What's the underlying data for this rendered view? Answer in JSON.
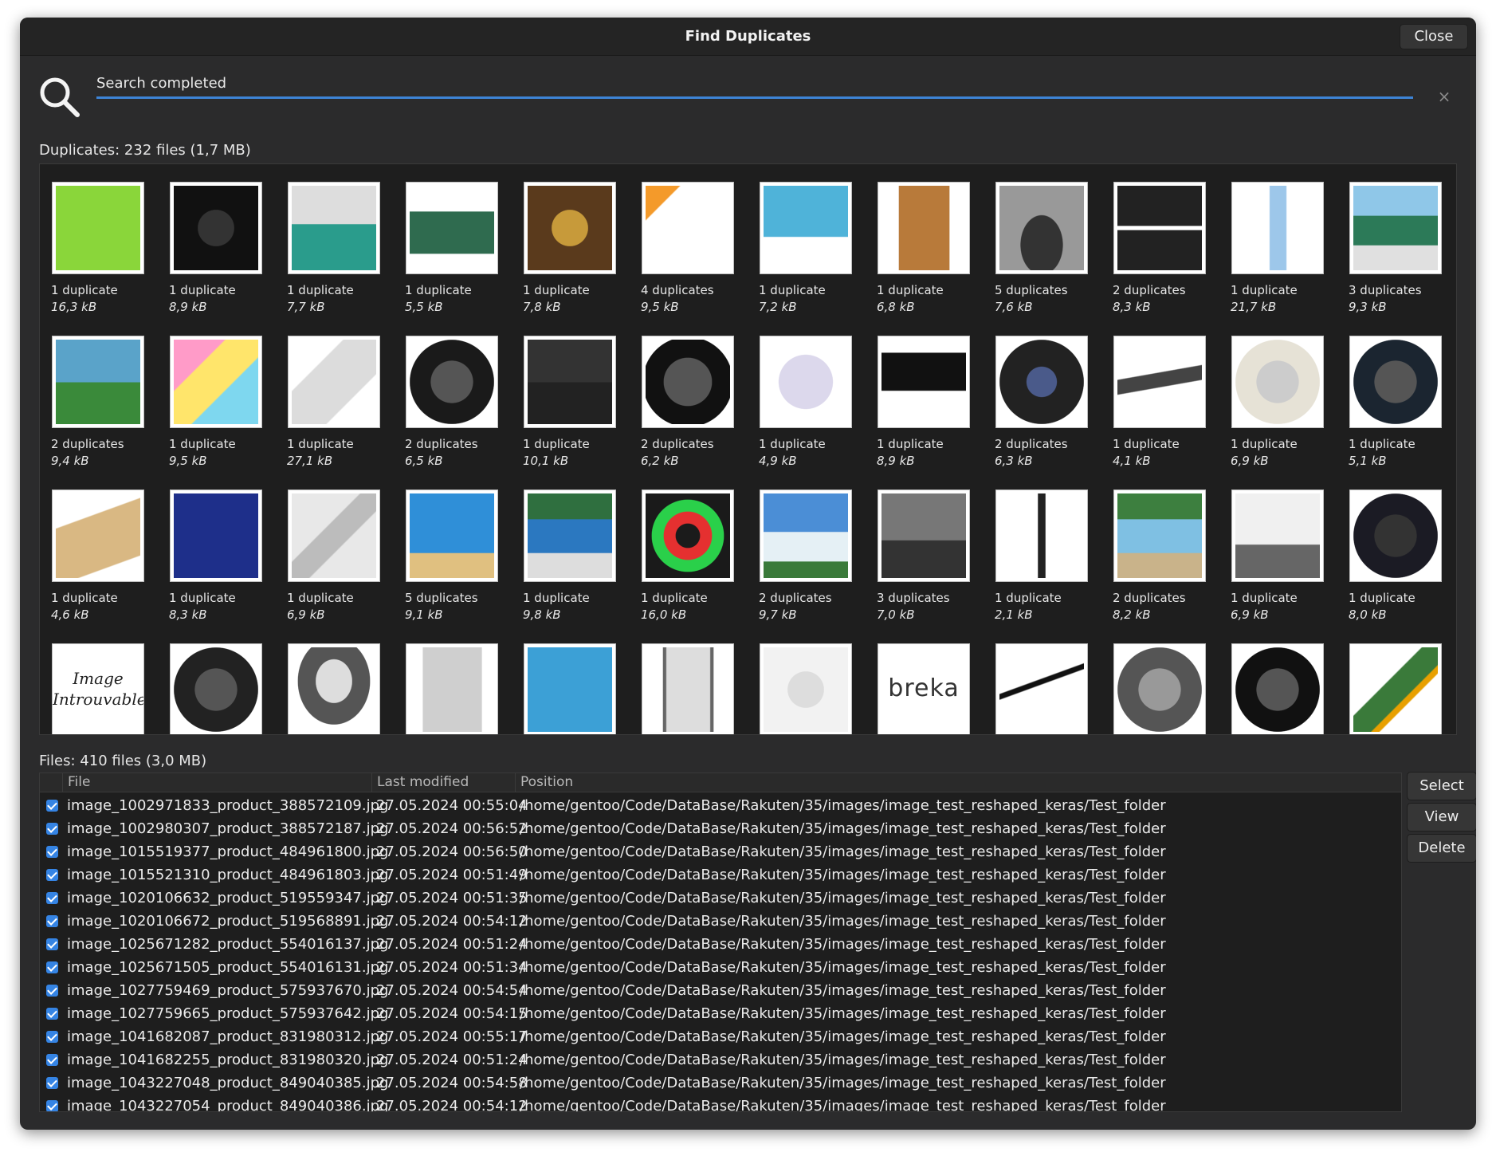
{
  "window": {
    "title": "Find Duplicates",
    "close_label": "Close"
  },
  "search": {
    "status": "Search completed",
    "progress": 1.0,
    "cancel_label": "×"
  },
  "duplicates": {
    "summary": "Duplicates: 232 files (1,7 MB)",
    "items": [
      {
        "count": "1 duplicate",
        "size": "16,3 kB"
      },
      {
        "count": "1 duplicate",
        "size": "8,9 kB"
      },
      {
        "count": "1 duplicate",
        "size": "7,7 kB"
      },
      {
        "count": "1 duplicate",
        "size": "5,5 kB"
      },
      {
        "count": "1 duplicate",
        "size": "7,8 kB"
      },
      {
        "count": "4 duplicates",
        "size": "9,5 kB"
      },
      {
        "count": "1 duplicate",
        "size": "7,2 kB"
      },
      {
        "count": "1 duplicate",
        "size": "6,8 kB"
      },
      {
        "count": "5 duplicates",
        "size": "7,6 kB"
      },
      {
        "count": "2 duplicates",
        "size": "8,3 kB"
      },
      {
        "count": "1 duplicate",
        "size": "21,7 kB"
      },
      {
        "count": "3 duplicates",
        "size": "9,3 kB"
      },
      {
        "count": "2 duplicates",
        "size": "9,4 kB"
      },
      {
        "count": "1 duplicate",
        "size": "9,5 kB"
      },
      {
        "count": "1 duplicate",
        "size": "27,1 kB"
      },
      {
        "count": "2 duplicates",
        "size": "6,5 kB"
      },
      {
        "count": "1 duplicate",
        "size": "10,1 kB"
      },
      {
        "count": "2 duplicates",
        "size": "6,2 kB"
      },
      {
        "count": "1 duplicate",
        "size": "4,9 kB"
      },
      {
        "count": "1 duplicate",
        "size": "8,9 kB"
      },
      {
        "count": "2 duplicates",
        "size": "6,3 kB"
      },
      {
        "count": "1 duplicate",
        "size": "4,1 kB"
      },
      {
        "count": "1 duplicate",
        "size": "6,9 kB"
      },
      {
        "count": "1 duplicate",
        "size": "5,1 kB"
      },
      {
        "count": "1 duplicate",
        "size": "4,6 kB"
      },
      {
        "count": "1 duplicate",
        "size": "8,3 kB"
      },
      {
        "count": "1 duplicate",
        "size": "6,9 kB"
      },
      {
        "count": "5 duplicates",
        "size": "9,1 kB"
      },
      {
        "count": "1 duplicate",
        "size": "9,8 kB"
      },
      {
        "count": "1 duplicate",
        "size": "16,0 kB"
      },
      {
        "count": "2 duplicates",
        "size": "9,7 kB"
      },
      {
        "count": "3 duplicates",
        "size": "7,0 kB"
      },
      {
        "count": "1 duplicate",
        "size": "2,1 kB"
      },
      {
        "count": "2 duplicates",
        "size": "8,2 kB"
      },
      {
        "count": "1 duplicate",
        "size": "6,9 kB"
      },
      {
        "count": "1 duplicate",
        "size": "8,0 kB"
      },
      {
        "count": "",
        "size": ""
      },
      {
        "count": "",
        "size": ""
      },
      {
        "count": "",
        "size": ""
      },
      {
        "count": "",
        "size": ""
      },
      {
        "count": "",
        "size": ""
      },
      {
        "count": "",
        "size": ""
      },
      {
        "count": "",
        "size": ""
      },
      {
        "count": "",
        "size": ""
      },
      {
        "count": "",
        "size": ""
      },
      {
        "count": "",
        "size": ""
      },
      {
        "count": "",
        "size": ""
      },
      {
        "count": "",
        "size": ""
      }
    ],
    "missing_image_text": "Image Introuvable",
    "brand_text": "breka"
  },
  "files": {
    "summary": "Files: 410 files (3,0 MB)",
    "columns": [
      "File",
      "Last modified",
      "Position"
    ],
    "rows": [
      {
        "checked": true,
        "file": "image_1002971833_product_388572109.jpg",
        "modified": "27.05.2024 00:55:04",
        "position": "/home/gentoo/Code/DataBase/Rakuten/35/images/image_test_reshaped_keras/Test_folder"
      },
      {
        "checked": true,
        "file": "image_1002980307_product_388572187.jpg",
        "modified": "27.05.2024 00:56:52",
        "position": "/home/gentoo/Code/DataBase/Rakuten/35/images/image_test_reshaped_keras/Test_folder"
      },
      {
        "checked": true,
        "file": "image_1015519377_product_484961800.jpg",
        "modified": "27.05.2024 00:56:50",
        "position": "/home/gentoo/Code/DataBase/Rakuten/35/images/image_test_reshaped_keras/Test_folder"
      },
      {
        "checked": true,
        "file": "image_1015521310_product_484961803.jpg",
        "modified": "27.05.2024 00:51:49",
        "position": "/home/gentoo/Code/DataBase/Rakuten/35/images/image_test_reshaped_keras/Test_folder"
      },
      {
        "checked": true,
        "file": "image_1020106632_product_519559347.jpg",
        "modified": "27.05.2024 00:51:35",
        "position": "/home/gentoo/Code/DataBase/Rakuten/35/images/image_test_reshaped_keras/Test_folder"
      },
      {
        "checked": true,
        "file": "image_1020106672_product_519568891.jpg",
        "modified": "27.05.2024 00:54:12",
        "position": "/home/gentoo/Code/DataBase/Rakuten/35/images/image_test_reshaped_keras/Test_folder"
      },
      {
        "checked": true,
        "file": "image_1025671282_product_554016137.jpg",
        "modified": "27.05.2024 00:51:24",
        "position": "/home/gentoo/Code/DataBase/Rakuten/35/images/image_test_reshaped_keras/Test_folder"
      },
      {
        "checked": true,
        "file": "image_1025671505_product_554016131.jpg",
        "modified": "27.05.2024 00:51:34",
        "position": "/home/gentoo/Code/DataBase/Rakuten/35/images/image_test_reshaped_keras/Test_folder"
      },
      {
        "checked": true,
        "file": "image_1027759469_product_575937670.jpg",
        "modified": "27.05.2024 00:54:54",
        "position": "/home/gentoo/Code/DataBase/Rakuten/35/images/image_test_reshaped_keras/Test_folder"
      },
      {
        "checked": true,
        "file": "image_1027759665_product_575937642.jpg",
        "modified": "27.05.2024 00:54:15",
        "position": "/home/gentoo/Code/DataBase/Rakuten/35/images/image_test_reshaped_keras/Test_folder"
      },
      {
        "checked": true,
        "file": "image_1041682087_product_831980312.jpg",
        "modified": "27.05.2024 00:55:17",
        "position": "/home/gentoo/Code/DataBase/Rakuten/35/images/image_test_reshaped_keras/Test_folder"
      },
      {
        "checked": true,
        "file": "image_1041682255_product_831980320.jpg",
        "modified": "27.05.2024 00:51:24",
        "position": "/home/gentoo/Code/DataBase/Rakuten/35/images/image_test_reshaped_keras/Test_folder"
      },
      {
        "checked": true,
        "file": "image_1043227048_product_849040385.jpg",
        "modified": "27.05.2024 00:54:58",
        "position": "/home/gentoo/Code/DataBase/Rakuten/35/images/image_test_reshaped_keras/Test_folder"
      },
      {
        "checked": true,
        "file": "image_1043227054_product_849040386.jpg",
        "modified": "27.05.2024 00:54:12",
        "position": "/home/gentoo/Code/DataBase/Rakuten/35/images/image_test_reshaped_keras/Test_folder"
      }
    ]
  },
  "actions": {
    "select_label": "Select",
    "view_label": "View",
    "delete_label": "Delete"
  }
}
